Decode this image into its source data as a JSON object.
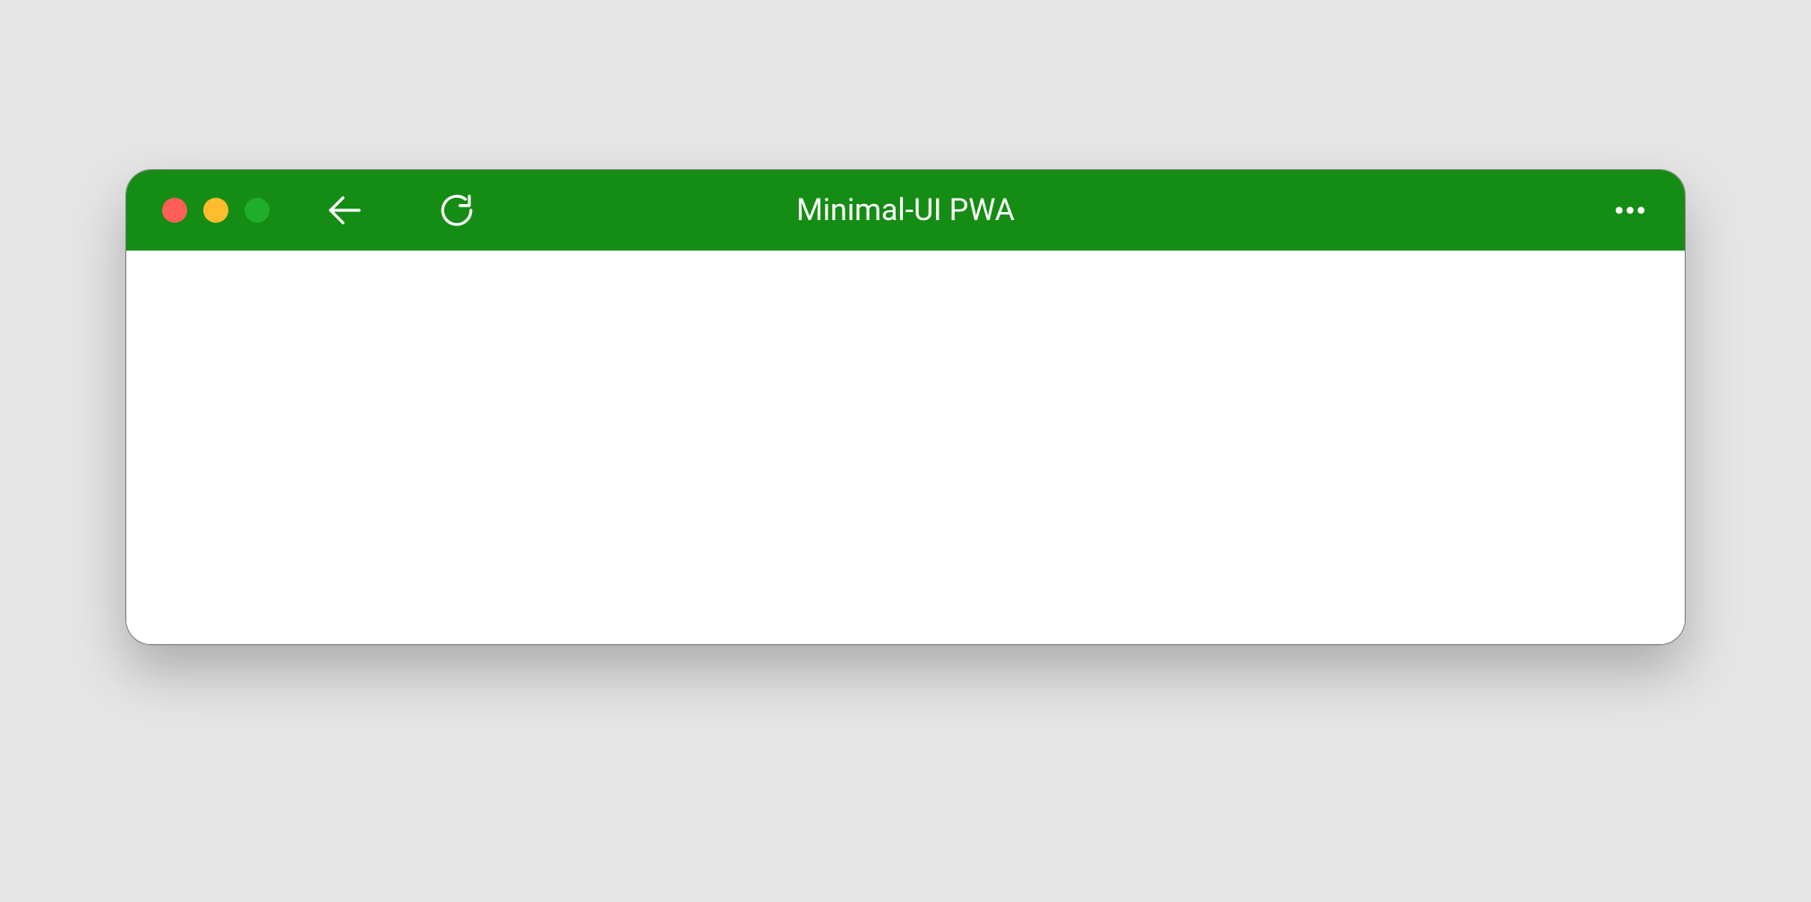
{
  "window": {
    "title": "Minimal-UI PWA"
  },
  "colors": {
    "titlebar_bg": "#158c14",
    "traffic_red": "#ff5f57",
    "traffic_yellow": "#ffbd2e",
    "traffic_green": "#28c840"
  }
}
